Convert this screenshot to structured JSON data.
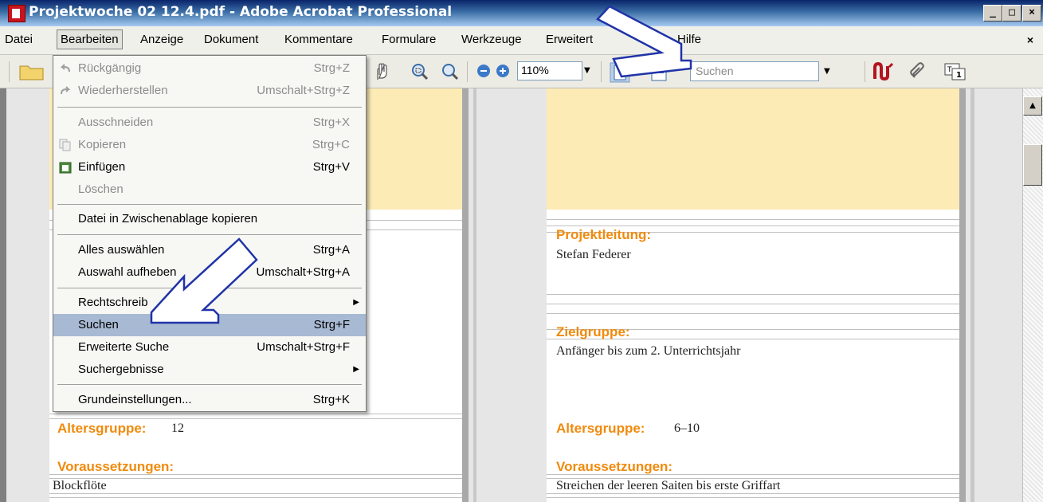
{
  "window": {
    "title": "Projektwoche 02 12.4.pdf - Adobe Acrobat Professional",
    "buttons": [
      "_",
      "□",
      "×"
    ]
  },
  "menubar": {
    "items": [
      "Datei",
      "Bearbeiten",
      "Anzeige",
      "Dokument",
      "Kommentare",
      "Formulare",
      "Werkzeuge",
      "Erweitert",
      "Hilfe"
    ],
    "close": "×"
  },
  "toolbar": {
    "zoom_value": "110%",
    "search_placeholder": "Suchen"
  },
  "dropdown": {
    "items": [
      {
        "label": "Rückgängig",
        "shortcut": "Strg+Z",
        "disabled": true
      },
      {
        "label": "Wiederherstellen",
        "shortcut": "Umschalt+Strg+Z",
        "disabled": true
      },
      {
        "label": "Ausschneiden",
        "shortcut": "Strg+X",
        "disabled": true
      },
      {
        "label": "Kopieren",
        "shortcut": "Strg+C",
        "disabled": true
      },
      {
        "label": "Einfügen",
        "shortcut": "Strg+V",
        "disabled": false
      },
      {
        "label": "Löschen",
        "shortcut": "",
        "disabled": true
      },
      {
        "label": "Datei in Zwischenablage kopieren",
        "shortcut": "",
        "disabled": false
      },
      {
        "label": "Alles auswählen",
        "shortcut": "Strg+A",
        "disabled": false
      },
      {
        "label": "Auswahl aufheben",
        "shortcut": "Umschalt+Strg+A",
        "disabled": false
      },
      {
        "label": "Rechtschreib",
        "shortcut": "",
        "disabled": false
      },
      {
        "label": "Suchen",
        "shortcut": "Strg+F",
        "disabled": false
      },
      {
        "label": "Erweiterte Suche",
        "shortcut": "Umschalt+Strg+F",
        "disabled": false
      },
      {
        "label": "Suchergebnisse",
        "shortcut": "",
        "disabled": false
      },
      {
        "label": "Grundeinstellungen...",
        "shortcut": "Strg+K",
        "disabled": false
      }
    ]
  },
  "document": {
    "left_page": {
      "age_heading": "Altersgruppe:",
      "age_value": "12",
      "prereq_heading": "Voraussetzungen:",
      "prereq_value": "Blockflöte"
    },
    "right_page": {
      "lead_heading": "Projektleitung:",
      "lead_value": "Stefan Federer",
      "target_heading": "Zielgruppe:",
      "target_value": "Anfänger bis zum 2. Unterrichtsjahr",
      "age_heading": "Altersgruppe:",
      "age_value": "6–10",
      "prereq_heading": "Voraussetzungen:",
      "prereq_value": "Streichen der leeren Saiten bis erste Griffart"
    }
  },
  "colors": {
    "accent": "#f08a0c",
    "band": "#fcebb5",
    "highlight": "#a7b9d3",
    "titlebar": "#0a246a"
  },
  "icons": [
    "folder-icon",
    "undo-icon",
    "redo-icon",
    "cut-icon",
    "copy-icon",
    "paste-icon",
    "hand-icon",
    "zoom-in-icon",
    "zoom-out-icon",
    "fit-page-icon",
    "fit-width-icon",
    "sign-icon",
    "attach-icon",
    "text-field-icon"
  ]
}
